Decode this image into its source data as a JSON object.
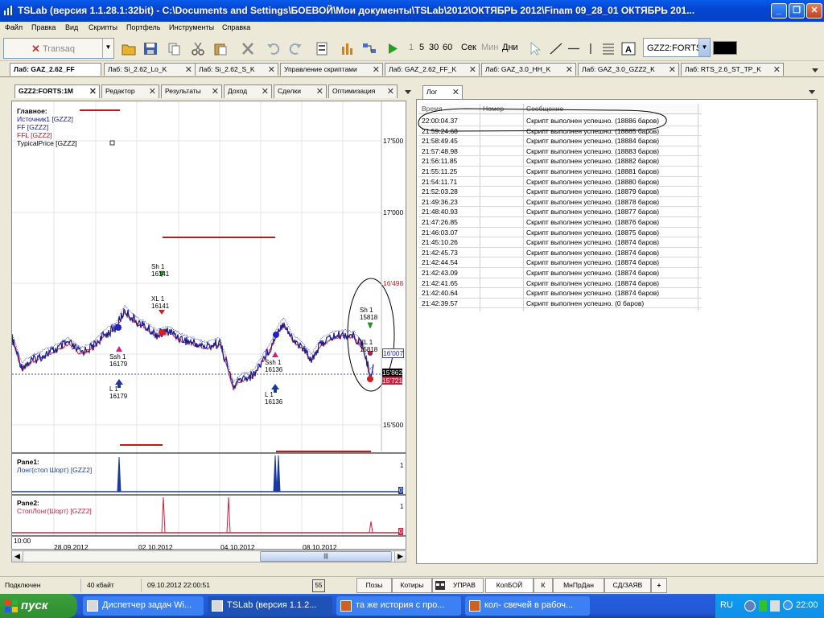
{
  "window": {
    "title": "TSLab (версия 1.1.28.1:32bit) - C:\\Documents and Settings\\БОЕВОЙ\\Мои документы\\TSLab\\2012\\ОКТЯБРЬ 2012\\Finam 09_28_01  ОКТЯБРЬ  201..."
  },
  "menu": [
    "Файл",
    "Правка",
    "Вид",
    "Скрипты",
    "Портфель",
    "Инструменты",
    "Справка"
  ],
  "toolbar": {
    "connection": "Transaq",
    "intervals": [
      "1",
      "5",
      "30",
      "60",
      "Сек",
      "Мин",
      "Дни"
    ],
    "symbol": "GZZ2:FORTS"
  },
  "doc_tabs": [
    "Лаб: GAZ_2.62_FF",
    "Лаб: Si_2.62_Lo_K",
    "Лаб: Si_2.62_S_K",
    "Управление скриптами",
    "Лаб: GAZ_2.62_FF_K",
    "Лаб: GAZ_3.0_HH_K",
    "Лаб: GAZ_3.0_GZZ2_K",
    "Лаб: RTS_2.6_ST_TP_K"
  ],
  "left_tabs": [
    "GZZ2:FORTS:1M",
    "Редактор",
    "Результаты",
    "Доход",
    "Сделки",
    "Оптимизация"
  ],
  "right_tabs": [
    "Лог"
  ],
  "chart": {
    "legend_title": "Главное:",
    "legend": [
      {
        "label": "Источник1 [GZZ2]",
        "color": "#1a1a9a"
      },
      {
        "label": "FF [GZZ2]",
        "color": "#1a1a9a"
      },
      {
        "label": "FFL [GZZ2]",
        "color": "#c01030"
      },
      {
        "label": "TypicalPrice [GZZ2]",
        "color": "#000000"
      }
    ],
    "price_labels": [
      "17'500",
      "17'000",
      "16'498",
      "16'007",
      "15'862",
      "15'721",
      "15'500"
    ],
    "signals": [
      {
        "line1": "Sh 1",
        "line2": "16141"
      },
      {
        "line1": "XL 1",
        "line2": "16141"
      },
      {
        "line1": "Ssh 1",
        "line2": "16179"
      },
      {
        "line1": "L 1",
        "line2": "16179"
      },
      {
        "line1": "Ssh 1",
        "line2": "16136"
      },
      {
        "line1": "L 1",
        "line2": "16136"
      },
      {
        "line1": "Sh 1",
        "line2": "15818"
      },
      {
        "line1": "XL 1",
        "line2": "15818"
      }
    ],
    "pane1": {
      "title": "Pane1:",
      "series": "Лонг(стоп Шорт) [GZZ2]",
      "scale_top": "1",
      "scale_bottom": "0"
    },
    "pane2": {
      "title": "Pane2:",
      "series": "СтопЛонг(Шорт) [GZZ2]",
      "scale_top": "1",
      "scale_bottom": "0"
    },
    "time_label": "10:00",
    "dates": [
      "28.09.2012",
      "02.10.2012",
      "04.10.2012",
      "08.10.2012"
    ]
  },
  "log": {
    "columns": [
      "Время",
      "Номер",
      "Сообщение"
    ],
    "rows": [
      {
        "time": "22:00:04.37",
        "msg": "Скрипт выполнен успешно. (18886 баров)"
      },
      {
        "time": "21:59:24.68",
        "msg": "Скрипт выполнен успешно. (18885 баров)"
      },
      {
        "time": "21:58:49.45",
        "msg": "Скрипт выполнен успешно. (18884 баров)"
      },
      {
        "time": "21:57:48.98",
        "msg": "Скрипт выполнен успешно. (18883 баров)"
      },
      {
        "time": "21:56:11.85",
        "msg": "Скрипт выполнен успешно. (18882 баров)"
      },
      {
        "time": "21:55:11.25",
        "msg": "Скрипт выполнен успешно. (18881 баров)"
      },
      {
        "time": "21:54:11.71",
        "msg": "Скрипт выполнен успешно. (18880 баров)"
      },
      {
        "time": "21:52:03.28",
        "msg": "Скрипт выполнен успешно. (18879 баров)"
      },
      {
        "time": "21:49:36.23",
        "msg": "Скрипт выполнен успешно. (18878 баров)"
      },
      {
        "time": "21:48:40.93",
        "msg": "Скрипт выполнен успешно. (18877 баров)"
      },
      {
        "time": "21:47:26.85",
        "msg": "Скрипт выполнен успешно. (18876 баров)"
      },
      {
        "time": "21:46:03.07",
        "msg": "Скрипт выполнен успешно. (18875 баров)"
      },
      {
        "time": "21:45:10.26",
        "msg": "Скрипт выполнен успешно. (18874 баров)"
      },
      {
        "time": "21:42:45.73",
        "msg": "Скрипт выполнен успешно. (18874 баров)"
      },
      {
        "time": "21:42:44.54",
        "msg": "Скрипт выполнен успешно. (18874 баров)"
      },
      {
        "time": "21:42:43.09",
        "msg": "Скрипт выполнен успешно. (18874 баров)"
      },
      {
        "time": "21:42:41.65",
        "msg": "Скрипт выполнен успешно. (18874 баров)"
      },
      {
        "time": "21:42:40.64",
        "msg": "Скрипт выполнен успешно. (18874 баров)"
      },
      {
        "time": "21:42:39.57",
        "msg": "Скрипт выполнен успешно. (0 баров)"
      }
    ]
  },
  "status": {
    "connection": "Подключен",
    "size": "40 кбайт",
    "datetime": "09.10.2012 22:00:51",
    "counter": "55"
  },
  "bottom_tabs": [
    "Позы",
    "Котиры",
    "УПРАВ",
    "КопБОЙ",
    "К",
    "МнПрДан",
    "СД/ЗАЯВ",
    "+"
  ],
  "taskbar": {
    "start": "пуск",
    "buttons": [
      "Диспетчер задач Wi...",
      "TSLab (версия 1.1.2...",
      "та же история с про...",
      "кол- свечей в рабоч..."
    ],
    "lang": "RU",
    "clock": "22:00"
  }
}
